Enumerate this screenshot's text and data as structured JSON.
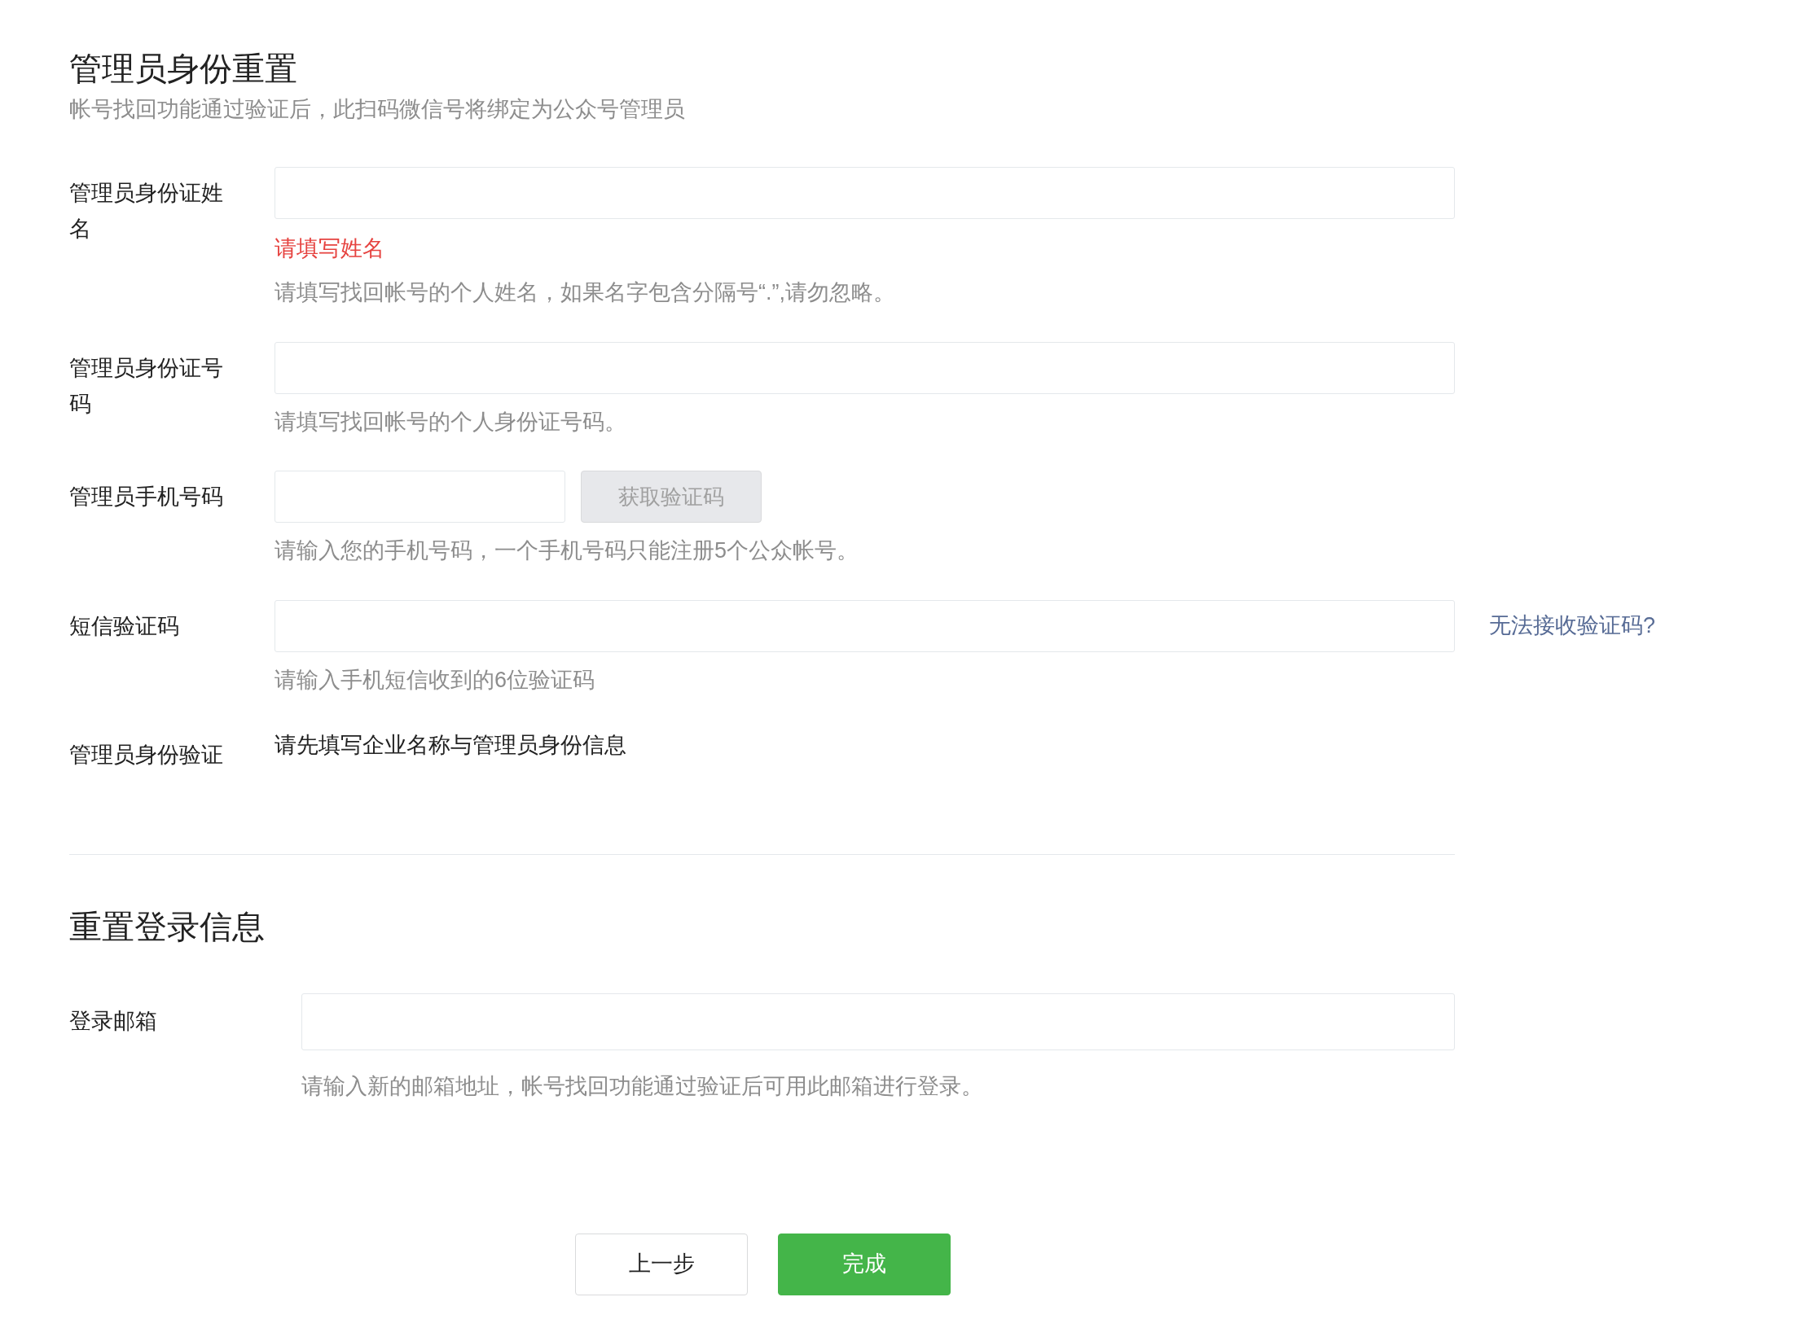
{
  "section1": {
    "title": "管理员身份重置",
    "subtitle": "帐号找回功能通过验证后，此扫码微信号将绑定为公众号管理员"
  },
  "fields": [
    {
      "kind": "input",
      "label": "管理员身份证姓名",
      "error": "请填写姓名",
      "hint": "请填写找回帐号的个人姓名，如果名字包含分隔号“.”,请勿忽略。"
    },
    {
      "kind": "input",
      "label": "管理员身份证号码",
      "hint": "请填写找回帐号的个人身份证号码。"
    },
    {
      "kind": "phone",
      "label": "管理员手机号码",
      "button": {
        "label": "获取验证码",
        "disabled": true
      },
      "hint": "请输入您的手机号码，一个手机号码只能注册5个公众帐号。"
    },
    {
      "kind": "input",
      "label": "短信验证码",
      "link": "无法接收验证码?",
      "hint": "请输入手机短信收到的6位验证码"
    },
    {
      "kind": "text",
      "label": "管理员身份验证",
      "value": "请先填写企业名称与管理员身份信息"
    }
  ],
  "section2": {
    "title": "重置登录信息",
    "fields": [
      {
        "label": "登录邮箱",
        "hint": "请输入新的邮箱地址，帐号找回功能通过验证后可用此邮箱进行登录。"
      }
    ]
  },
  "buttons": [
    {
      "kind": "secondary",
      "label": "上一步"
    },
    {
      "kind": "primary",
      "label": "完成"
    }
  ]
}
